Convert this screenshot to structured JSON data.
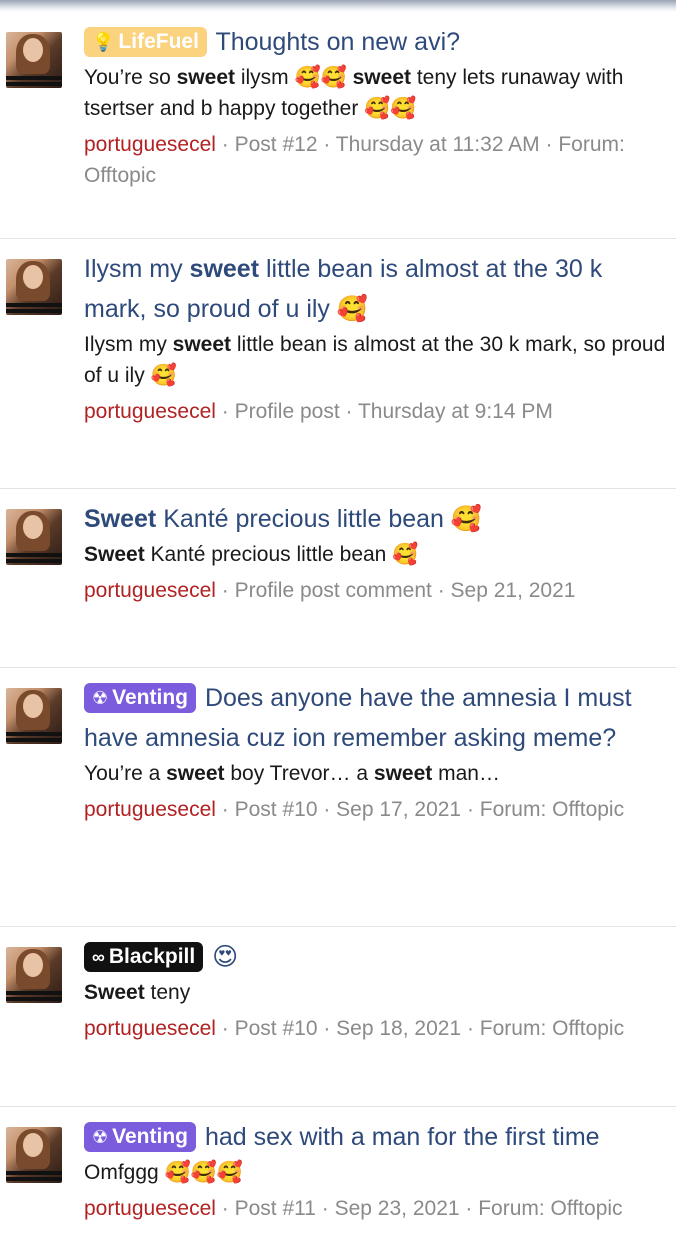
{
  "items": [
    {
      "prefix": "LifeFuel",
      "prefix_icon": "lightbulb-icon",
      "title": "Thoughts on new avi?",
      "snippet_parts": [
        "You’re so ",
        "sweet",
        " ilysm 🥰🥰 ",
        "sweet",
        " teny lets runaway with tsertser and b happy together 🥰🥰"
      ],
      "author": "portuguesecel",
      "meta": "· Post #12 · Thursday at 11:32 AM · Forum: Offtopic"
    },
    {
      "title_parts": [
        "Ilysm my ",
        "sweet",
        " little bean is almost at the 30 k mark, so proud of u ily 🥰"
      ],
      "snippet_parts": [
        "Ilysm my ",
        "sweet",
        " little bean is almost at the 30 k mark, so proud of u ily 🥰"
      ],
      "author": "portuguesecel",
      "meta": "· Profile post · Thursday at 9:14 PM"
    },
    {
      "title_parts": [
        "Sweet",
        " Kanté precious little bean 🥰"
      ],
      "snippet_parts": [
        "Sweet",
        " Kanté precious little bean 🥰"
      ],
      "author": "portuguesecel",
      "meta": "· Profile post comment · Sep 21, 2021"
    },
    {
      "prefix": "Venting",
      "prefix_icon": "radiation-icon",
      "title": "Does anyone have the amnesia I must have amnesia cuz ion remember asking meme?",
      "snippet_parts": [
        "You’re a ",
        "sweet",
        " boy Trevor… a ",
        "sweet",
        " man…"
      ],
      "author": "portuguesecel",
      "meta": "· Post #10 · Sep 17, 2021 · Forum: Offtopic"
    },
    {
      "prefix": "Blackpill",
      "prefix_icon": "pill-icon",
      "title": "😍",
      "snippet_parts": [
        "Sweet",
        " teny"
      ],
      "author": "portuguesecel",
      "meta": "· Post #10 · Sep 18, 2021 · Forum: Offtopic"
    },
    {
      "prefix": "Venting",
      "prefix_icon": "radiation-icon",
      "title": "had sex with a man for the first time",
      "snippet_parts": [
        "Omfggg 🥰🥰🥰"
      ],
      "author": "portuguesecel",
      "meta": "· Post #11 · Sep 23, 2021 · Forum: Offtopic"
    }
  ]
}
